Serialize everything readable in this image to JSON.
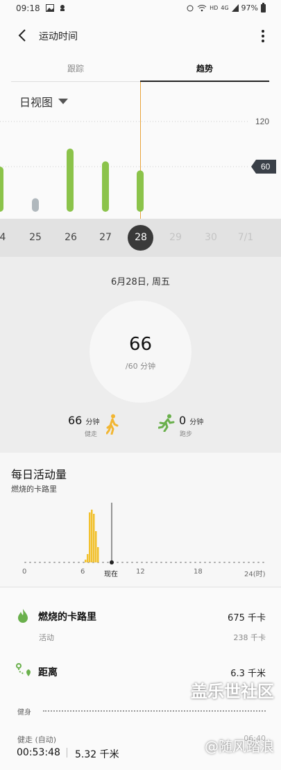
{
  "status_bar": {
    "time": "09:18",
    "network": "HD",
    "signal": "4G",
    "battery": "97%"
  },
  "header": {
    "title": "运动时间"
  },
  "tabs": [
    {
      "label": "跟踪",
      "selected": false
    },
    {
      "label": "趋势",
      "selected": true
    }
  ],
  "trend": {
    "view_selector": "日视图",
    "accent": "#8bc34a",
    "marker_color": "#e8a33a"
  },
  "chart_data": {
    "type": "bar",
    "categories": [
      "24",
      "25",
      "26",
      "27",
      "28"
    ],
    "values": [
      60,
      18,
      84,
      67,
      55
    ],
    "goal_met": [
      true,
      false,
      true,
      true,
      true
    ],
    "ylim": [
      0,
      120
    ],
    "reference_lines": [
      120,
      60
    ],
    "reference_labels": [
      "120",
      "60"
    ],
    "title": "",
    "xlabel": "",
    "ylabel": ""
  },
  "date_strip": {
    "items": [
      {
        "label": "4",
        "state": "normal"
      },
      {
        "label": "25",
        "state": "normal"
      },
      {
        "label": "26",
        "state": "normal"
      },
      {
        "label": "27",
        "state": "normal"
      },
      {
        "label": "28",
        "state": "selected"
      },
      {
        "label": "29",
        "state": "faded"
      },
      {
        "label": "30",
        "state": "faded"
      },
      {
        "label": "7/1",
        "state": "faded"
      }
    ]
  },
  "summary": {
    "date": "6月28日, 周五",
    "minutes": "66",
    "goal": "/60 分钟",
    "walk": {
      "value": "66",
      "unit": "分钟",
      "label": "健走"
    },
    "run": {
      "value": "0",
      "unit": "分钟",
      "label": "跑步"
    }
  },
  "daily": {
    "title": "每日活动量",
    "subtitle": "燃烧的卡路里",
    "now_label": "现在",
    "axis_labels": [
      "0",
      "6",
      "12",
      "18",
      "24(时)"
    ],
    "bar_color": "#f2c12e"
  },
  "details": {
    "calories": {
      "title": "燃烧的卡路里",
      "value": "675 千卡",
      "sub_label": "活动",
      "sub_value": "238 千卡"
    },
    "distance": {
      "title": "距离",
      "value": "6.3 千米"
    },
    "fitness_label": "健身",
    "walk_auto_label": "健走 (自动)",
    "walk_time": "00:53:48",
    "walk_distance": "5.32 千米",
    "walk_time_right": "06:40"
  },
  "watermark": {
    "line1": "盖乐世社区",
    "line2": "@随风踏浪"
  }
}
